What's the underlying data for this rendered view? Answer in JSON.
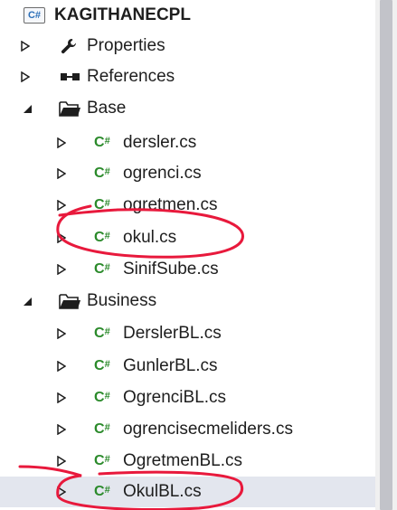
{
  "colors": {
    "selection": "#e3e6ee",
    "csharp_icon": "#2b8a2b",
    "annotation": "#e8193c",
    "scrollbar_thumb": "#c2c3c9"
  },
  "project": {
    "icon_text": "C#",
    "name": "KAGITHANECPL"
  },
  "properties": {
    "label": "Properties",
    "icon": "wrench-icon",
    "expander": "collapsed"
  },
  "references": {
    "label": "References",
    "icon": "references-icon",
    "expander": "collapsed"
  },
  "folder_base": {
    "label": "Base",
    "icon": "folder-open-icon",
    "expander": "expanded",
    "files": [
      {
        "label": "dersler.cs"
      },
      {
        "label": "ogrenci.cs"
      },
      {
        "label": "ogretmen.cs"
      },
      {
        "label": "okul.cs"
      },
      {
        "label": "SinifSube.cs"
      }
    ]
  },
  "folder_business": {
    "label": "Business",
    "icon": "folder-open-icon",
    "expander": "expanded",
    "files": [
      {
        "label": "DerslerBL.cs"
      },
      {
        "label": "GunlerBL.cs"
      },
      {
        "label": "OgrenciBL.cs"
      },
      {
        "label": "ogrencisecmeliders.cs"
      },
      {
        "label": "OgretmenBL.cs"
      },
      {
        "label": "OkulBL.cs",
        "selected": true
      }
    ]
  },
  "cs_icon_text": "C",
  "cs_icon_sup": "#",
  "annotations": [
    "circle-okul-cs",
    "circle-okulbl-cs"
  ]
}
